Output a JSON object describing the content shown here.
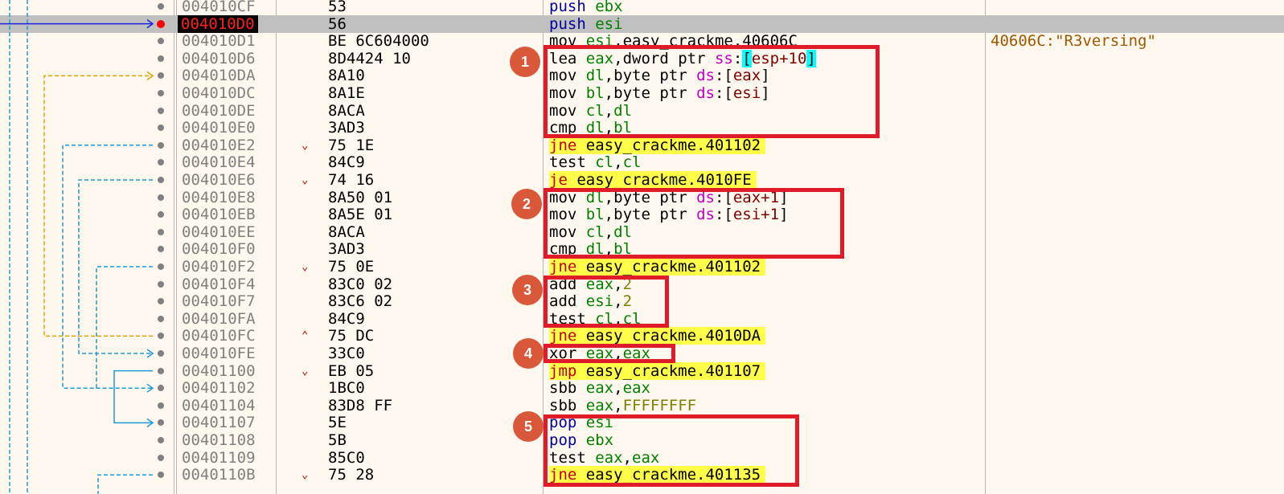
{
  "rows": [
    {
      "addr": "004010CF",
      "bytes": "53",
      "arrow": "",
      "parts": [
        {
          "t": "push",
          "c": "kw push"
        },
        {
          "t": " "
        },
        {
          "t": "ebx",
          "c": "reg"
        }
      ],
      "hl": false,
      "comment": "",
      "dot": "normal"
    },
    {
      "addr": "004010D0",
      "bytes": "56",
      "arrow": "",
      "parts": [
        {
          "t": "push",
          "c": "kw push"
        },
        {
          "t": " "
        },
        {
          "t": "esi",
          "c": "reg"
        }
      ],
      "hl": false,
      "comment": "",
      "dot": "bp",
      "current": true
    },
    {
      "addr": "004010D1",
      "bytes": "BE 6C604000",
      "arrow": "",
      "parts": [
        {
          "t": "mov",
          "c": "kw"
        },
        {
          "t": " "
        },
        {
          "t": "esi",
          "c": "reg"
        },
        {
          "t": ","
        },
        {
          "t": "easy_crackme.40606C",
          "c": "sym"
        }
      ],
      "hl": false,
      "comment": "40606C:\"R3versing\"",
      "dot": "normal"
    },
    {
      "addr": "004010D6",
      "bytes": "8D4424 10",
      "arrow": "",
      "parts": [
        {
          "t": "lea",
          "c": "kw"
        },
        {
          "t": " "
        },
        {
          "t": "eax",
          "c": "reg"
        },
        {
          "t": ","
        },
        {
          "t": "dword ptr ",
          "c": "sym"
        },
        {
          "t": "ss",
          "c": "seg"
        },
        {
          "t": ":"
        },
        {
          "t": "[",
          "c": "hlbox"
        },
        {
          "t": "esp+10",
          "c": "mem"
        },
        {
          "t": "]",
          "c": "hlbox"
        }
      ],
      "hl": false,
      "comment": "",
      "dot": "normal"
    },
    {
      "addr": "004010DA",
      "bytes": "8A10",
      "arrow": "",
      "parts": [
        {
          "t": "mov",
          "c": "kw"
        },
        {
          "t": " "
        },
        {
          "t": "dl",
          "c": "reg"
        },
        {
          "t": ","
        },
        {
          "t": "byte ptr ",
          "c": "sym"
        },
        {
          "t": "ds",
          "c": "seg"
        },
        {
          "t": ":["
        },
        {
          "t": "eax",
          "c": "mem"
        },
        {
          "t": "]"
        }
      ],
      "hl": false,
      "comment": "",
      "dot": "normal"
    },
    {
      "addr": "004010DC",
      "bytes": "8A1E",
      "arrow": "",
      "parts": [
        {
          "t": "mov",
          "c": "kw"
        },
        {
          "t": " "
        },
        {
          "t": "bl",
          "c": "reg"
        },
        {
          "t": ","
        },
        {
          "t": "byte ptr ",
          "c": "sym"
        },
        {
          "t": "ds",
          "c": "seg"
        },
        {
          "t": ":["
        },
        {
          "t": "esi",
          "c": "mem"
        },
        {
          "t": "]"
        }
      ],
      "hl": false,
      "comment": "",
      "dot": "normal"
    },
    {
      "addr": "004010DE",
      "bytes": "8ACA",
      "arrow": "",
      "parts": [
        {
          "t": "mov",
          "c": "kw"
        },
        {
          "t": " "
        },
        {
          "t": "cl",
          "c": "reg"
        },
        {
          "t": ","
        },
        {
          "t": "dl",
          "c": "reg"
        }
      ],
      "hl": false,
      "comment": "",
      "dot": "normal"
    },
    {
      "addr": "004010E0",
      "bytes": "3AD3",
      "arrow": "",
      "parts": [
        {
          "t": "cmp",
          "c": "kw"
        },
        {
          "t": " "
        },
        {
          "t": "dl",
          "c": "reg"
        },
        {
          "t": ","
        },
        {
          "t": "bl",
          "c": "reg"
        }
      ],
      "hl": false,
      "comment": "",
      "dot": "normal"
    },
    {
      "addr": "004010E2",
      "bytes": "75 1E",
      "arrow": "⌄",
      "parts": [
        {
          "t": "jne",
          "c": "kw j"
        },
        {
          "t": " "
        },
        {
          "t": "easy_crackme.401102",
          "c": "sym"
        }
      ],
      "hl": true,
      "comment": "",
      "dot": "normal"
    },
    {
      "addr": "004010E4",
      "bytes": "84C9",
      "arrow": "",
      "parts": [
        {
          "t": "test",
          "c": "kw"
        },
        {
          "t": " "
        },
        {
          "t": "cl",
          "c": "reg"
        },
        {
          "t": ","
        },
        {
          "t": "cl",
          "c": "reg"
        }
      ],
      "hl": false,
      "comment": "",
      "dot": "normal"
    },
    {
      "addr": "004010E6",
      "bytes": "74 16",
      "arrow": "⌄",
      "parts": [
        {
          "t": "je",
          "c": "kw j"
        },
        {
          "t": " "
        },
        {
          "t": "easy_crackme.4010FE",
          "c": "sym"
        }
      ],
      "hl": true,
      "comment": "",
      "dot": "normal"
    },
    {
      "addr": "004010E8",
      "bytes": "8A50 01",
      "arrow": "",
      "parts": [
        {
          "t": "mov",
          "c": "kw"
        },
        {
          "t": " "
        },
        {
          "t": "dl",
          "c": "reg"
        },
        {
          "t": ","
        },
        {
          "t": "byte ptr ",
          "c": "sym"
        },
        {
          "t": "ds",
          "c": "seg"
        },
        {
          "t": ":["
        },
        {
          "t": "eax+1",
          "c": "mem"
        },
        {
          "t": "]"
        }
      ],
      "hl": false,
      "comment": "",
      "dot": "normal"
    },
    {
      "addr": "004010EB",
      "bytes": "8A5E 01",
      "arrow": "",
      "parts": [
        {
          "t": "mov",
          "c": "kw"
        },
        {
          "t": " "
        },
        {
          "t": "bl",
          "c": "reg"
        },
        {
          "t": ","
        },
        {
          "t": "byte ptr ",
          "c": "sym"
        },
        {
          "t": "ds",
          "c": "seg"
        },
        {
          "t": ":["
        },
        {
          "t": "esi+1",
          "c": "mem"
        },
        {
          "t": "]"
        }
      ],
      "hl": false,
      "comment": "",
      "dot": "normal"
    },
    {
      "addr": "004010EE",
      "bytes": "8ACA",
      "arrow": "",
      "parts": [
        {
          "t": "mov",
          "c": "kw"
        },
        {
          "t": " "
        },
        {
          "t": "cl",
          "c": "reg"
        },
        {
          "t": ","
        },
        {
          "t": "dl",
          "c": "reg"
        }
      ],
      "hl": false,
      "comment": "",
      "dot": "normal"
    },
    {
      "addr": "004010F0",
      "bytes": "3AD3",
      "arrow": "",
      "parts": [
        {
          "t": "cmp",
          "c": "kw"
        },
        {
          "t": " "
        },
        {
          "t": "dl",
          "c": "reg"
        },
        {
          "t": ","
        },
        {
          "t": "bl",
          "c": "reg"
        }
      ],
      "hl": false,
      "comment": "",
      "dot": "normal"
    },
    {
      "addr": "004010F2",
      "bytes": "75 0E",
      "arrow": "⌄",
      "parts": [
        {
          "t": "jne",
          "c": "kw j"
        },
        {
          "t": " "
        },
        {
          "t": "easy_crackme.401102",
          "c": "sym"
        }
      ],
      "hl": true,
      "comment": "",
      "dot": "normal"
    },
    {
      "addr": "004010F4",
      "bytes": "83C0 02",
      "arrow": "",
      "parts": [
        {
          "t": "add",
          "c": "kw"
        },
        {
          "t": " "
        },
        {
          "t": "eax",
          "c": "reg"
        },
        {
          "t": ","
        },
        {
          "t": "2",
          "c": "num"
        }
      ],
      "hl": false,
      "comment": "",
      "dot": "normal"
    },
    {
      "addr": "004010F7",
      "bytes": "83C6 02",
      "arrow": "",
      "parts": [
        {
          "t": "add",
          "c": "kw"
        },
        {
          "t": " "
        },
        {
          "t": "esi",
          "c": "reg"
        },
        {
          "t": ","
        },
        {
          "t": "2",
          "c": "num"
        }
      ],
      "hl": false,
      "comment": "",
      "dot": "normal"
    },
    {
      "addr": "004010FA",
      "bytes": "84C9",
      "arrow": "",
      "parts": [
        {
          "t": "test",
          "c": "kw"
        },
        {
          "t": " "
        },
        {
          "t": "cl",
          "c": "reg"
        },
        {
          "t": ","
        },
        {
          "t": "cl",
          "c": "reg"
        }
      ],
      "hl": false,
      "comment": "",
      "dot": "normal"
    },
    {
      "addr": "004010FC",
      "bytes": "75 DC",
      "arrow": "⌃",
      "parts": [
        {
          "t": "jne",
          "c": "kw j"
        },
        {
          "t": " "
        },
        {
          "t": "easy_crackme.4010DA",
          "c": "sym"
        }
      ],
      "hl": true,
      "comment": "",
      "dot": "normal"
    },
    {
      "addr": "004010FE",
      "bytes": "33C0",
      "arrow": "",
      "parts": [
        {
          "t": "xor",
          "c": "kw"
        },
        {
          "t": " "
        },
        {
          "t": "eax",
          "c": "reg"
        },
        {
          "t": ","
        },
        {
          "t": "eax",
          "c": "reg"
        }
      ],
      "hl": false,
      "comment": "",
      "dot": "normal"
    },
    {
      "addr": "00401100",
      "bytes": "EB 05",
      "arrow": "⌄",
      "parts": [
        {
          "t": "jmp",
          "c": "kw j"
        },
        {
          "t": " "
        },
        {
          "t": "easy_crackme.401107",
          "c": "sym"
        }
      ],
      "hl": true,
      "comment": "",
      "dot": "normal"
    },
    {
      "addr": "00401102",
      "bytes": "1BC0",
      "arrow": "",
      "parts": [
        {
          "t": "sbb",
          "c": "kw"
        },
        {
          "t": " "
        },
        {
          "t": "eax",
          "c": "reg"
        },
        {
          "t": ","
        },
        {
          "t": "eax",
          "c": "reg"
        }
      ],
      "hl": false,
      "comment": "",
      "dot": "normal"
    },
    {
      "addr": "00401104",
      "bytes": "83D8 FF",
      "arrow": "",
      "parts": [
        {
          "t": "sbb",
          "c": "kw"
        },
        {
          "t": " "
        },
        {
          "t": "eax",
          "c": "reg"
        },
        {
          "t": ","
        },
        {
          "t": "FFFFFFFF",
          "c": "num"
        }
      ],
      "hl": false,
      "comment": "",
      "dot": "normal"
    },
    {
      "addr": "00401107",
      "bytes": "5E",
      "arrow": "",
      "parts": [
        {
          "t": "pop",
          "c": "kw push"
        },
        {
          "t": " "
        },
        {
          "t": "esi",
          "c": "reg"
        }
      ],
      "hl": false,
      "comment": "",
      "dot": "normal"
    },
    {
      "addr": "00401108",
      "bytes": "5B",
      "arrow": "",
      "parts": [
        {
          "t": "pop",
          "c": "kw push"
        },
        {
          "t": " "
        },
        {
          "t": "ebx",
          "c": "reg"
        }
      ],
      "hl": false,
      "comment": "",
      "dot": "normal"
    },
    {
      "addr": "00401109",
      "bytes": "85C0",
      "arrow": "",
      "parts": [
        {
          "t": "test",
          "c": "kw"
        },
        {
          "t": " "
        },
        {
          "t": "eax",
          "c": "reg"
        },
        {
          "t": ","
        },
        {
          "t": "eax",
          "c": "reg"
        }
      ],
      "hl": false,
      "comment": "",
      "dot": "normal"
    },
    {
      "addr": "0040110B",
      "bytes": "75 28",
      "arrow": "⌄",
      "parts": [
        {
          "t": "jne",
          "c": "kw j"
        },
        {
          "t": " "
        },
        {
          "t": "easy_crackme.401135",
          "c": "sym"
        }
      ],
      "hl": true,
      "comment": "",
      "dot": "normal"
    }
  ],
  "annotations": [
    {
      "label": "1"
    },
    {
      "label": "2"
    },
    {
      "label": "3"
    },
    {
      "label": "4"
    },
    {
      "label": "5"
    }
  ],
  "colors": {
    "background": "#fff8ef",
    "highlight": "#ffff4a",
    "current_row": "#c0c0c0",
    "box": "#e01c2a",
    "badge": "#d9583a",
    "jump_blue": "#1a9ad8",
    "jump_orange": "#e0a000",
    "eip_arrow": "#2020e0"
  }
}
